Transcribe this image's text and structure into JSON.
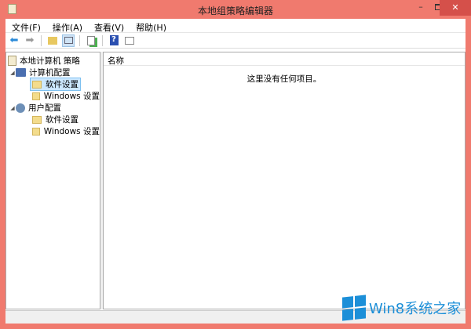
{
  "window": {
    "title": "本地组策略编辑器",
    "minimize": "–",
    "close": "✕"
  },
  "menu": [
    "文件(F)",
    "操作(A)",
    "查看(V)",
    "帮助(H)"
  ],
  "toolbar": {
    "back": "⬅",
    "forward": "➡",
    "help": "?"
  },
  "tree": {
    "root": "本地计算机 策略",
    "computer": "计算机配置",
    "computer_children": [
      "软件设置",
      "Windows 设置"
    ],
    "user": "用户配置",
    "user_children": [
      "软件设置",
      "Windows 设置"
    ]
  },
  "list": {
    "column": "名称",
    "empty": "这里没有任何项目。"
  },
  "watermark": "Win8系统之家",
  "colors": {
    "title_bar": "#f07a6e",
    "close": "#d5504a",
    "accent": "#1c8fd8"
  }
}
